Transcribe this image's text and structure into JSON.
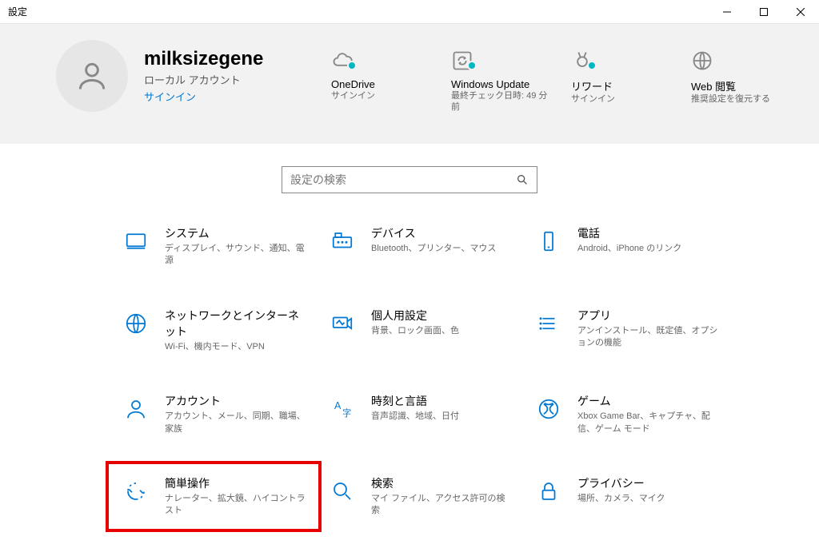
{
  "window": {
    "title": "設定"
  },
  "user": {
    "name": "milksizegene",
    "type": "ローカル アカウント",
    "signin": "サインイン"
  },
  "status": {
    "onedrive": {
      "title": "OneDrive",
      "sub": "サインイン"
    },
    "update": {
      "title": "Windows Update",
      "sub": "最終チェック日時: 49 分前"
    },
    "rewards": {
      "title": "リワード",
      "sub": "サインイン"
    },
    "web": {
      "title": "Web 閲覧",
      "sub": "推奨設定を復元する"
    }
  },
  "search": {
    "placeholder": "設定の検索"
  },
  "categories": {
    "system": {
      "title": "システム",
      "desc": "ディスプレイ、サウンド、通知、電源"
    },
    "devices": {
      "title": "デバイス",
      "desc": "Bluetooth、プリンター、マウス"
    },
    "phone": {
      "title": "電話",
      "desc": "Android、iPhone のリンク"
    },
    "network": {
      "title": "ネットワークとインターネット",
      "desc": "Wi-Fi、機内モード、VPN"
    },
    "personalization": {
      "title": "個人用設定",
      "desc": "背景、ロック画面、色"
    },
    "apps": {
      "title": "アプリ",
      "desc": "アンインストール、既定値、オプションの機能"
    },
    "accounts": {
      "title": "アカウント",
      "desc": "アカウント、メール、同期、職場、家族"
    },
    "time": {
      "title": "時刻と言語",
      "desc": "音声認識、地域、日付"
    },
    "gaming": {
      "title": "ゲーム",
      "desc": "Xbox Game Bar、キャプチャ、配信、ゲーム モード"
    },
    "ease": {
      "title": "簡単操作",
      "desc": "ナレーター、拡大鏡、ハイコントラスト"
    },
    "searchcat": {
      "title": "検索",
      "desc": "マイ ファイル、アクセス許可の検索"
    },
    "privacy": {
      "title": "プライバシー",
      "desc": "場所、カメラ、マイク"
    }
  }
}
